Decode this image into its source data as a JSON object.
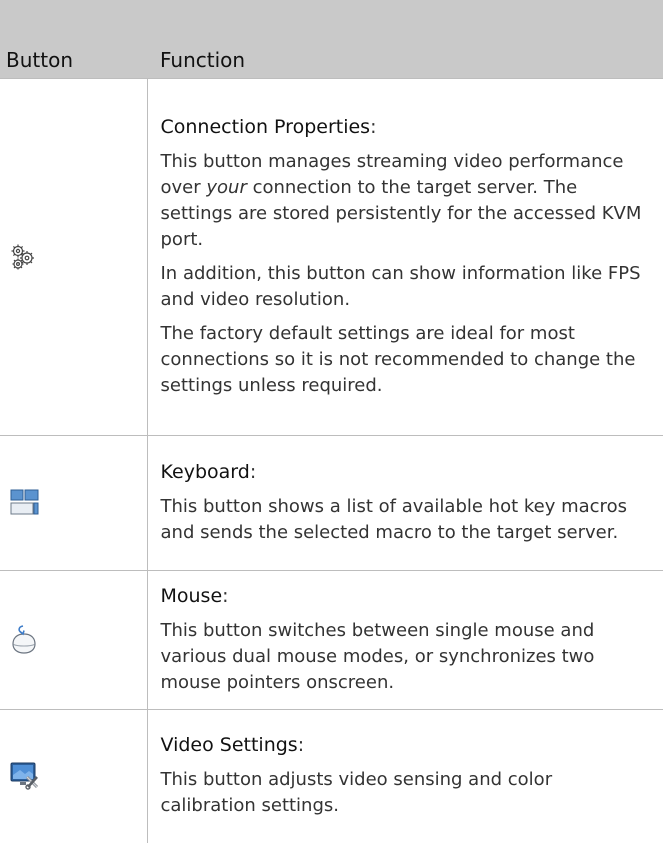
{
  "table": {
    "headers": {
      "button": "Button",
      "function": "Function"
    },
    "rows": [
      {
        "icon": "connection-properties-gear-icon",
        "title": "Connection Properties",
        "colon": ":",
        "paragraphs": [
          {
            "before": "This button manages streaming video performance over ",
            "emphasis": "your",
            "after": " connection to the target server. The settings are stored persistently for the accessed KVM port."
          },
          {
            "text": "In addition, this button can show information like FPS and video resolution."
          },
          {
            "text": "The factory default settings are ideal for most connections so it is not recommended to change the settings unless required."
          }
        ]
      },
      {
        "icon": "keyboard-icon",
        "title": "Keyboard",
        "colon": ":",
        "paragraphs": [
          {
            "text": "This button shows a list of available hot key macros and sends the selected macro to the target server."
          }
        ]
      },
      {
        "icon": "mouse-icon",
        "title": "Mouse",
        "colon": ":",
        "paragraphs": [
          {
            "text": "This button switches between single mouse and various dual mouse modes, or synchronizes two mouse pointers onscreen."
          }
        ]
      },
      {
        "icon": "video-settings-icon",
        "title": "Video Settings",
        "colon": ":",
        "paragraphs": [
          {
            "text": "This button adjusts video sensing and color calibration settings."
          }
        ]
      }
    ]
  },
  "colors": {
    "header_background": "#c9c9c9",
    "border": "#bdbdbd",
    "icon_blue": "#4a86c8"
  }
}
